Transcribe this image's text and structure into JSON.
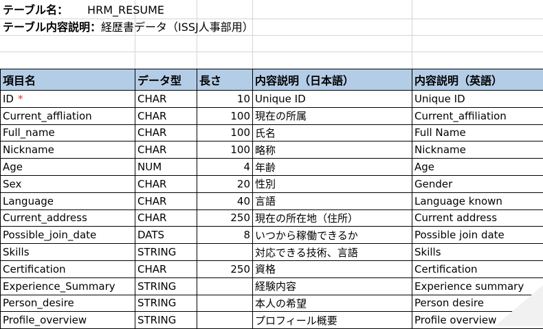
{
  "title": {
    "label": "テーブル名：",
    "value": "HRM_RESUME"
  },
  "description": {
    "label": "テーブル内容説明：",
    "value": "経歴書データ（ISSJ人事部用）"
  },
  "table": {
    "headers": [
      "項目名",
      "データ型",
      "長さ",
      "内容説明（日本語）",
      "内容説明（英語）"
    ],
    "required_mark": "*",
    "rows": [
      {
        "name": "ID",
        "type": "CHAR",
        "length": "10",
        "ja": "Unique ID",
        "en": "Unique ID"
      },
      {
        "name": "Current_affliation",
        "type": "CHAR",
        "length": "100",
        "ja": "現在の所属",
        "en": "Current_affiliation"
      },
      {
        "name": "Full_name",
        "type": "CHAR",
        "length": "100",
        "ja": "氏名",
        "en": "Full Name"
      },
      {
        "name": "Nickname",
        "type": "CHAR",
        "length": "100",
        "ja": "略称",
        "en": "Nickname"
      },
      {
        "name": "Age",
        "type": "NUM",
        "length": "4",
        "ja": "年齢",
        "en": "Age"
      },
      {
        "name": "Sex",
        "type": "CHAR",
        "length": "20",
        "ja": "性別",
        "en": "Gender"
      },
      {
        "name": "Language",
        "type": "CHAR",
        "length": "40",
        "ja": "言語",
        "en": "Language known"
      },
      {
        "name": "Current_address",
        "type": "CHAR",
        "length": "250",
        "ja": "現在の所在地（住所）",
        "en": "Current address"
      },
      {
        "name": "Possible_join_date",
        "type": "DATS",
        "length": "8",
        "ja": "いつから稼働できるか",
        "en": "Possible join date"
      },
      {
        "name": "Skills",
        "type": "STRING",
        "length": "",
        "ja": "対応できる技術、言語",
        "en": "Skills"
      },
      {
        "name": "Certification",
        "type": "CHAR",
        "length": "250",
        "ja": "資格",
        "en": "Certification"
      },
      {
        "name": "Experience_Summary",
        "type": "STRING",
        "length": "",
        "ja": "経験内容",
        "en": "Experience summary"
      },
      {
        "name": "Person_desire",
        "type": "STRING",
        "length": "",
        "ja": "本人の希望",
        "en": "Person desire"
      },
      {
        "name": "Profile_overview",
        "type": "STRING",
        "length": "",
        "ja": "プロフィール概要",
        "en": "Profile overview"
      }
    ]
  }
}
